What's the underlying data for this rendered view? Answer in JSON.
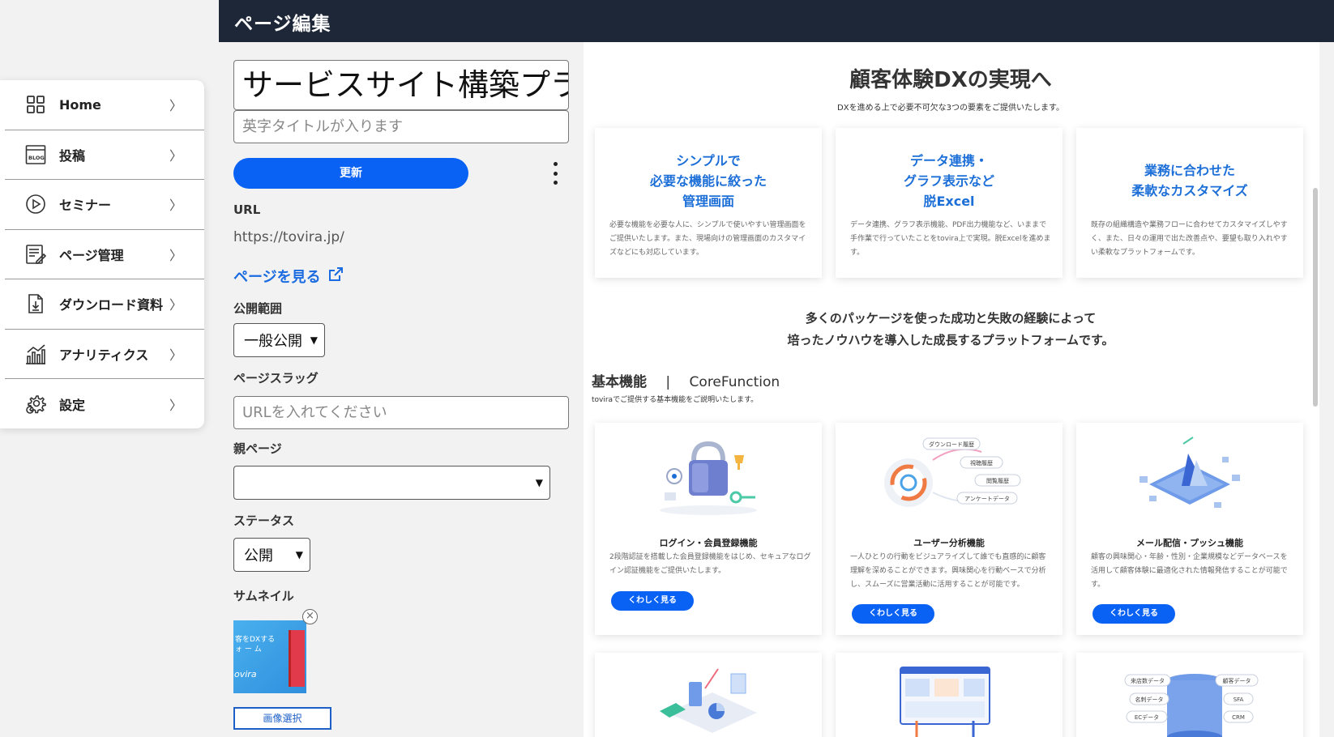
{
  "header": {
    "title": "ページ編集"
  },
  "sidebar": {
    "items": [
      {
        "label": "Home",
        "icon": "grid-icon"
      },
      {
        "label": "投稿",
        "icon": "blog-icon"
      },
      {
        "label": "セミナー",
        "icon": "play-circle-icon"
      },
      {
        "label": "ページ管理",
        "icon": "page-edit-icon"
      },
      {
        "label": "ダウンロード資料",
        "icon": "download-doc-icon"
      },
      {
        "label": "アナリティクス",
        "icon": "analytics-icon"
      },
      {
        "label": "設定",
        "icon": "gear-icon"
      }
    ],
    "chevron": "〉"
  },
  "form": {
    "title_value": "サービスサイト構築プラ",
    "en_title_placeholder": "英字タイトルが入ります",
    "update_label": "更新",
    "url_label": "URL",
    "url_value": "https://tovira.jp/",
    "view_page_label": "ページを見る",
    "visibility_label": "公開範囲",
    "visibility_value": "一般公開",
    "slug_label": "ページスラッグ",
    "slug_placeholder": "URLを入れてください",
    "parent_label": "親ページ",
    "parent_value": "",
    "status_label": "ステータス",
    "status_value": "公開",
    "thumbnail_label": "サムネイル",
    "thumbnail_text": "客をDXする\nォ ー ム",
    "thumbnail_logo": "ovira",
    "image_select_label": "画像選択"
  },
  "preview": {
    "heading": "顧客体験DXの実現へ",
    "subheading": "DXを進める上で必要不可欠な3つの要素をご提供いたします。",
    "cards": [
      {
        "title": "シンプルで\n必要な機能に絞った\n管理画面",
        "body": "必要な機能を必要な人に、シンプルで使いやすい管理画面をご提供いたします。また、現場向けの管理画面のカスタマイズなどにも対応しています。"
      },
      {
        "title": "データ連携・\nグラフ表示など\n脱Excel",
        "body": "データ連携、グラフ表示機能、PDF出力機能など、いままで手作業で行っていたことをtovira上で実現。脱Excelを進めます。"
      },
      {
        "title": "業務に合わせた\n柔軟なカスタマイズ",
        "body": "既存の組織構造や業務フローに合わせてカスタマイズしやすく、また、日々の運用で出た改善点や、要望も取り入れやすい柔軟なプラットフォームです。"
      }
    ],
    "mid_text": "多くのパッケージを使った成功と失敗の経験によって\n培ったノウハウを導入した成長するプラットフォームです。",
    "section_title": "基本機能",
    "section_divider": "|",
    "section_title_en": "CoreFunction",
    "section_sub": "toviraでご提供する基本機能をご説明いたします。",
    "features": [
      {
        "title": "ログイン・会員登録機能",
        "body": "2段階認証を搭載した会員登録機能をはじめ、セキュアなログイン認証機能をご提供いたします。",
        "button": "くわしく見る"
      },
      {
        "title": "ユーザー分析機能",
        "body": "一人ひとりの行動をビジュアライズして誰でも直感的に顧客理解を深めることができます。興味関心を行動ベースで分析し、スムーズに営業活動に活用することが可能です。",
        "button": "くわしく見る",
        "tags": [
          "ダウンロード履歴",
          "視聴履歴",
          "閲覧履歴",
          "アンケートデータ"
        ]
      },
      {
        "title": "メール配信・プッシュ機能",
        "body": "顧客の興味関心・年齢・性別・企業規模などデータベースを活用して顧客体験に最適化された情報発信することが可能です。",
        "button": "くわしく見る"
      }
    ],
    "bottom_tags": [
      "来店数データ",
      "顧客データ",
      "名刺データ",
      "SFA",
      "ECデータ",
      "CRM"
    ]
  },
  "colors": {
    "header_bg": "#1e2738",
    "accent": "#0a62f5",
    "link": "#1b6ce0",
    "card_title": "#1d6fd8"
  }
}
